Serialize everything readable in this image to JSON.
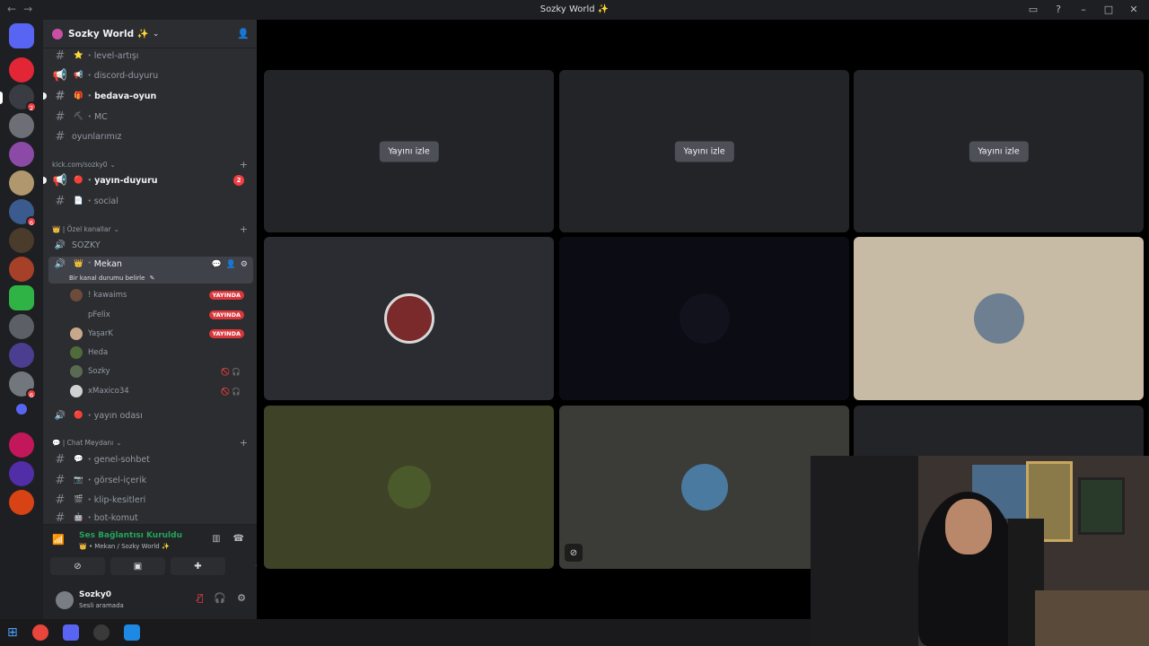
{
  "window": {
    "title": "Sozky World ✨",
    "nav_back": "←",
    "nav_forward": "→"
  },
  "guild": {
    "name": "Sozky World ✨"
  },
  "channels_top": [
    {
      "name": "level-artışı",
      "emoji": "⭐",
      "unread": false
    },
    {
      "name": "discord-duyuru",
      "emoji": "📢",
      "unread": false,
      "voice_style": true
    },
    {
      "name": "bedava-oyun",
      "emoji": "🎁",
      "unread": true
    },
    {
      "name": "MC",
      "emoji": "⛏",
      "unread": false
    },
    {
      "name": "oyunlarımız",
      "emoji": "",
      "unread": false
    }
  ],
  "category_kick": {
    "label": "kick.com/sozky0",
    "channels": [
      {
        "name": "yayın-duyuru",
        "emoji": "🔴",
        "unread": true,
        "mention": "2"
      },
      {
        "name": "social",
        "emoji": "📄",
        "unread": false
      }
    ]
  },
  "category_ozel": {
    "label": "👑 | Özel kanallar",
    "voice_channels": [
      {
        "name": "SOZKY"
      },
      {
        "name": "Mekan",
        "emoji": "👑",
        "active": true,
        "status_hint": "Bir kanal durumu belirle"
      }
    ]
  },
  "voice_users": [
    {
      "name": "! kawaims",
      "live": "YAYINDA"
    },
    {
      "name": "pFelix",
      "live": "YAYINDA"
    },
    {
      "name": "YaşarK",
      "live": "YAYINDA"
    },
    {
      "name": "Heda",
      "live": ""
    },
    {
      "name": "Sozky",
      "live": "",
      "muted": true
    },
    {
      "name": "xMaxico34",
      "live": "",
      "muted": true
    }
  ],
  "voice_channel_yayin": {
    "name": "yayın odası",
    "emoji": "🔴"
  },
  "category_chat": {
    "label": "💬 | Chat Meydanı",
    "channels": [
      {
        "name": "genel-sohbet",
        "emoji": "💬"
      },
      {
        "name": "görsel-içerik",
        "emoji": "📷"
      },
      {
        "name": "klip-kesitleri",
        "emoji": "🎬"
      },
      {
        "name": "bot-komut",
        "emoji": "🤖"
      }
    ]
  },
  "voice_panel": {
    "title": "Ses Bağlantısı Kuruldu",
    "subtitle": "👑 • Mekan / Sozky World ✨"
  },
  "user_panel": {
    "name": "Sozky0",
    "status": "Sesli aramada"
  },
  "stage": {
    "watch_label": "Yayını izle"
  },
  "colors": {
    "accent_green": "#23a55a",
    "live_red": "#da373c",
    "mention_red": "#f23f43"
  }
}
